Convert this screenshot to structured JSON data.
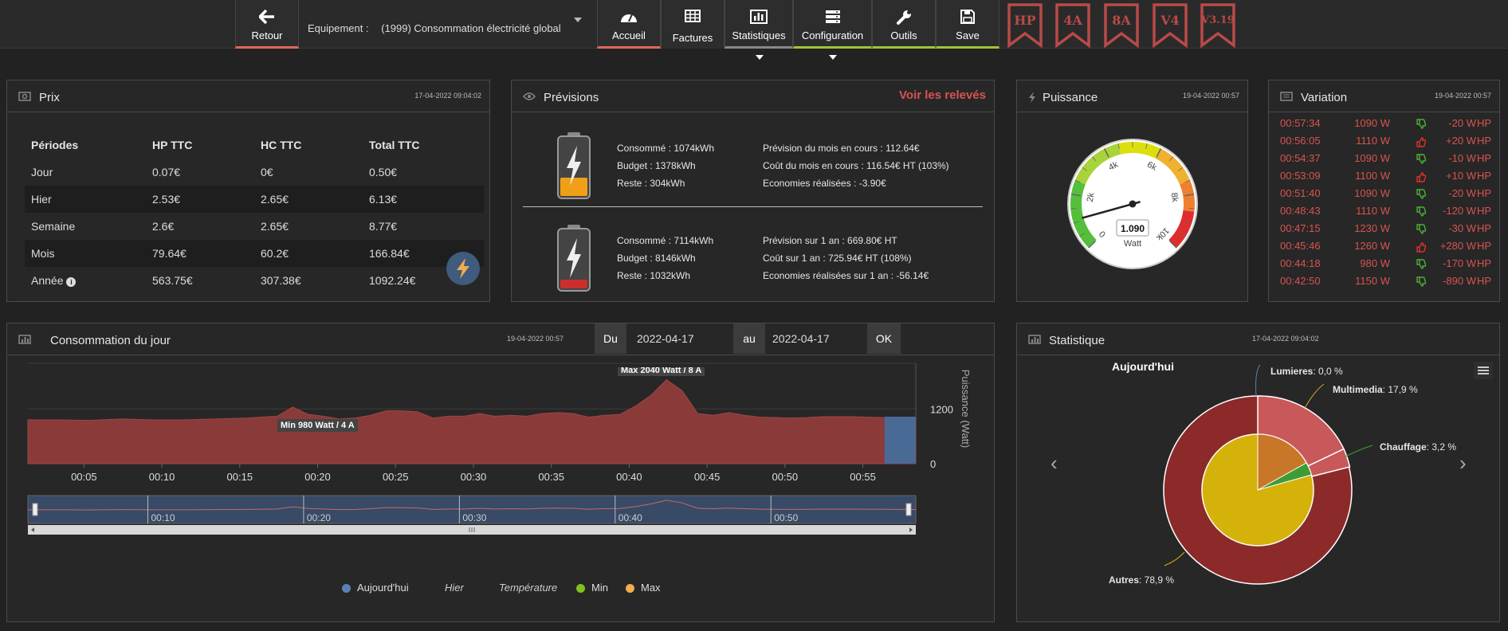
{
  "topbar": {
    "back_label": "Retour",
    "equipment_label": "Equipement :",
    "equipment_value": "(1999) Consommation électricité global",
    "nav": [
      {
        "label": "Accueil",
        "icon": "dashboard-icon"
      },
      {
        "label": "Factures",
        "icon": "table-icon"
      },
      {
        "label": "Statistiques",
        "icon": "bar-chart-icon"
      },
      {
        "label": "Configuration",
        "icon": "server-icon"
      },
      {
        "label": "Outils",
        "icon": "wrench-icon"
      },
      {
        "label": "Save",
        "icon": "floppy-icon"
      }
    ],
    "badges": [
      "HP",
      "4A",
      "8A",
      "V4",
      "V3.19"
    ]
  },
  "prix": {
    "title": "Prix",
    "date": "17-04-2022 09:04:02",
    "headers": [
      "Périodes",
      "HP TTC",
      "HC TTC",
      "Total TTC"
    ],
    "rows": [
      [
        "Jour",
        "0.07€",
        "0€",
        "0.50€"
      ],
      [
        "Hier",
        "2.53€",
        "2.65€",
        "6.13€"
      ],
      [
        "Semaine",
        "2.6€",
        "2.65€",
        "8.77€"
      ],
      [
        "Mois",
        "79.64€",
        "60.2€",
        "166.84€"
      ],
      [
        "Année",
        "563.75€",
        "307.38€",
        "1092.24€"
      ]
    ],
    "info_glyph": "i"
  },
  "previsions": {
    "title": "Prévisions",
    "link": "Voir les relevés",
    "month": {
      "left": [
        "Consommé : 1074kWh",
        "Budget : 1378kWh",
        "Reste : 304kWh"
      ],
      "right": [
        "Prévision du mois en cours : 112.64€",
        "Coût du mois en cours : 116.54€ HT (103%)",
        "Economies réalisées : -3.90€"
      ]
    },
    "year": {
      "left": [
        "Consommé : 7114kWh",
        "Budget : 8146kWh",
        "Reste : 1032kWh"
      ],
      "right": [
        "Prévision sur 1 an : 669.80€ HT",
        "Coût sur 1 an : 725.94€ HT (108%)",
        "Economies réalisées sur 1 an : -56.14€"
      ]
    }
  },
  "puissance": {
    "title": "Puissance",
    "date": "19-04-2022 00:57",
    "value": "1.090",
    "value_num": 1090,
    "unit": "Watt",
    "ticks": [
      "0",
      "2k",
      "4k",
      "6k",
      "8k",
      "10k"
    ],
    "max": 10000
  },
  "variation": {
    "title": "Variation",
    "date": "19-04-2022 00:57",
    "rows": [
      {
        "time": "00:57:34",
        "watt": "1090 W",
        "delta": "-20 W",
        "tarif": "HP",
        "dir": "down"
      },
      {
        "time": "00:56:05",
        "watt": "1110 W",
        "delta": "+20 W",
        "tarif": "HP",
        "dir": "up"
      },
      {
        "time": "00:54:37",
        "watt": "1090 W",
        "delta": "-10 W",
        "tarif": "HP",
        "dir": "down"
      },
      {
        "time": "00:53:09",
        "watt": "1100 W",
        "delta": "+10 W",
        "tarif": "HP",
        "dir": "up"
      },
      {
        "time": "00:51:40",
        "watt": "1090 W",
        "delta": "-20 W",
        "tarif": "HP",
        "dir": "down"
      },
      {
        "time": "00:48:43",
        "watt": "1110 W",
        "delta": "-120 W",
        "tarif": "HP",
        "dir": "down"
      },
      {
        "time": "00:47:15",
        "watt": "1230 W",
        "delta": "-30 W",
        "tarif": "HP",
        "dir": "down"
      },
      {
        "time": "00:45:46",
        "watt": "1260 W",
        "delta": "+280 W",
        "tarif": "HP",
        "dir": "up"
      },
      {
        "time": "00:44:18",
        "watt": "980 W",
        "delta": "-170 W",
        "tarif": "HP",
        "dir": "down"
      },
      {
        "time": "00:42:50",
        "watt": "1150 W",
        "delta": "-890 W",
        "tarif": "HP",
        "dir": "down"
      }
    ]
  },
  "conso": {
    "title": "Consommation du jour",
    "date": "19-04-2022 00:57",
    "du_label": "Du",
    "du_value": "2022-04-17",
    "au_label": "au",
    "au_value": "2022-04-17",
    "ok_label": "OK",
    "min_label": "Min 980 Watt / 4 A",
    "max_label": "Max 2040 Watt / 8 A",
    "legend": [
      "Aujourd'hui",
      "Hier",
      "Température",
      "Min",
      "Max"
    ],
    "navigator_ticks": [
      "00:10",
      "00:20",
      "00:30",
      "00:40",
      "00:50"
    ]
  },
  "statistique": {
    "title": "Statistique",
    "date": "17-04-2022 09:04:02",
    "subtitle": "Aujourd'hui",
    "labels": [
      {
        "name": "Lumieres",
        "value": ": 0,0 %"
      },
      {
        "name": "Multimedia",
        "value": ": 17,9 %"
      },
      {
        "name": "Chauffage",
        "value": ": 3,2 %"
      },
      {
        "name": "Autres",
        "value": ": 78,9 %"
      }
    ],
    "prev_glyph": "‹",
    "next_glyph": "›"
  },
  "chart_data": {
    "type": "area",
    "ylabel": "Puissance (Watt)",
    "ylim": [
      0,
      2200
    ],
    "ytick_labels": [
      "0",
      "1200"
    ],
    "xtick_labels": [
      "00:05",
      "00:10",
      "00:15",
      "00:20",
      "00:25",
      "00:30",
      "00:35",
      "00:40",
      "00:45",
      "00:50",
      "00:55"
    ],
    "x": [
      0,
      2,
      4,
      6,
      8,
      10,
      12,
      14,
      16,
      17,
      18,
      19,
      20,
      21,
      22,
      23,
      24,
      25,
      26,
      27,
      28,
      29,
      30,
      31,
      32,
      33,
      34,
      35,
      36,
      37,
      38,
      39,
      40,
      41,
      42,
      43,
      44,
      45,
      46,
      47,
      48,
      49,
      50,
      51,
      52,
      53,
      54,
      55,
      57
    ],
    "series": [
      {
        "name": "Aujourd'hui",
        "values": [
          960,
          960,
          950,
          980,
          960,
          960,
          980,
          1000,
          1040,
          1240,
          1080,
          1040,
          980,
          1000,
          1060,
          1160,
          1160,
          1140,
          1000,
          1040,
          1040,
          1100,
          1040,
          1060,
          1040,
          1100,
          1120,
          1100,
          1020,
          1060,
          1080,
          1260,
          1500,
          1840,
          1600,
          1100,
          1060,
          1120,
          1060,
          1020,
          1010,
          1000,
          1010,
          1030,
          1030,
          1030,
          1020,
          1010,
          990
        ]
      }
    ],
    "today_start": 55
  }
}
